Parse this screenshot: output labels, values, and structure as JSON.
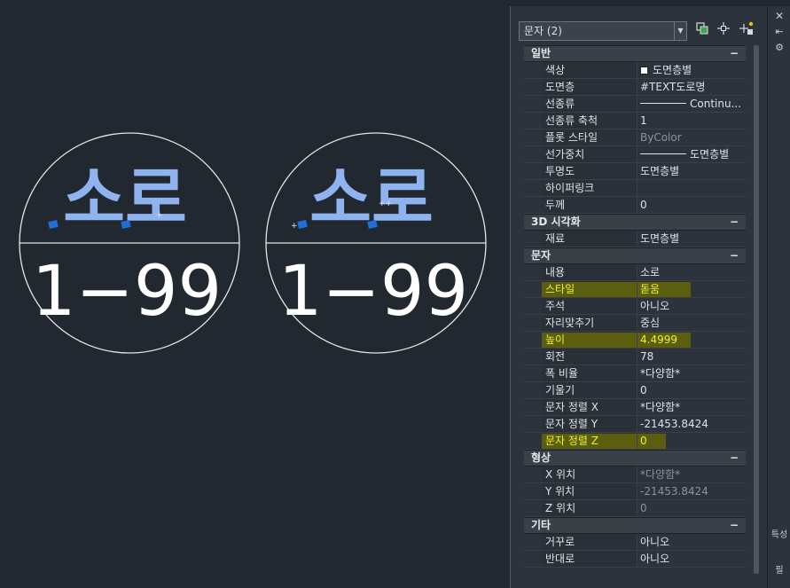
{
  "canvas": {
    "drawings": [
      {
        "top_text": "소로",
        "bottom_text": "1−99"
      },
      {
        "top_text": "소로",
        "bottom_text": "1−99"
      }
    ]
  },
  "palette": {
    "selection": "문자 (2)",
    "categories": [
      {
        "title": "일반",
        "collapse": "−",
        "rows": [
          {
            "name": "색상",
            "value": "도면층별",
            "swatch": true
          },
          {
            "name": "도면층",
            "value": "#TEXT도로명"
          },
          {
            "name": "선종류",
            "value": "Continu...",
            "line": true
          },
          {
            "name": "선종류 축척",
            "value": "1"
          },
          {
            "name": "플롯 스타일",
            "value": "ByColor",
            "dim": true
          },
          {
            "name": "선가중치",
            "value": "도면층별",
            "line": true
          },
          {
            "name": "투명도",
            "value": "도면층별"
          },
          {
            "name": "하이퍼링크",
            "value": ""
          },
          {
            "name": "두께",
            "value": "0"
          }
        ]
      },
      {
        "title": "3D 시각화",
        "collapse": "−",
        "rows": [
          {
            "name": "재료",
            "value": "도면층별"
          }
        ]
      },
      {
        "title": "문자",
        "collapse": "−",
        "rows": [
          {
            "name": "내용",
            "value": "소로"
          },
          {
            "name": "스타일",
            "value": "돋움",
            "highlight": true
          },
          {
            "name": "주석",
            "value": "아니오"
          },
          {
            "name": "자리맞추기",
            "value": "중심"
          },
          {
            "name": "높이",
            "value": "4.4999",
            "highlight": true
          },
          {
            "name": "회전",
            "value": "78"
          },
          {
            "name": "폭 비율",
            "value": "*다양함*"
          },
          {
            "name": "기울기",
            "value": "0"
          },
          {
            "name": "문자 정렬 X",
            "value": "*다양함*"
          },
          {
            "name": "문자 정렬 Y",
            "value": "-21453.8424"
          },
          {
            "name": "문자 정렬 Z",
            "value": "0",
            "highlight": true
          }
        ]
      },
      {
        "title": "형상",
        "collapse": "−",
        "rows": [
          {
            "name": "X 위치",
            "value": "*다양함*",
            "dim": true
          },
          {
            "name": "Y 위치",
            "value": "-21453.8424",
            "dim": true
          },
          {
            "name": "Z 위치",
            "value": "0",
            "dim": true
          }
        ]
      },
      {
        "title": "기타",
        "collapse": "−",
        "rows": [
          {
            "name": "거꾸로",
            "value": "아니오"
          },
          {
            "name": "반대로",
            "value": "아니오"
          }
        ]
      }
    ],
    "strip": {
      "close": "✕",
      "autohide": "⇤",
      "settings": "⚙",
      "vertical_title": "특성",
      "vertical_title_2": "필"
    }
  },
  "colors": {
    "canvas_bg": "#212830",
    "selected_text": "#8fb3ee",
    "grip": "#1f6fd6",
    "highlight": "#5b5e0e"
  }
}
